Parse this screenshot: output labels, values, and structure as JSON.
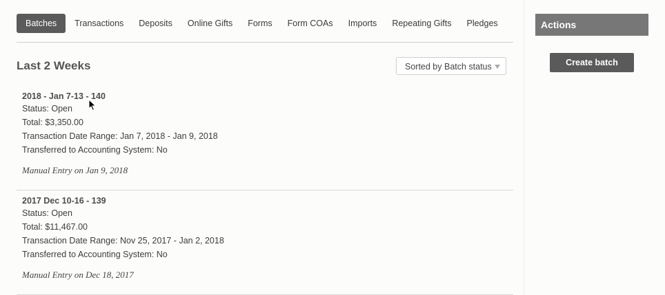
{
  "tabs": [
    {
      "label": "Batches",
      "active": true
    },
    {
      "label": "Transactions"
    },
    {
      "label": "Deposits"
    },
    {
      "label": "Online Gifts"
    },
    {
      "label": "Forms"
    },
    {
      "label": "Form COAs"
    },
    {
      "label": "Imports"
    },
    {
      "label": "Repeating Gifts"
    },
    {
      "label": "Pledges"
    }
  ],
  "section": {
    "title": "Last 2 Weeks"
  },
  "sort": {
    "label": "Sorted by Batch status"
  },
  "batches": [
    {
      "name": "2018 - Jan 7-13 - 140",
      "status": "Status: Open",
      "total": "Total: $3,350.00",
      "date_range": "Transaction Date Range: Jan 7, 2018 - Jan 9, 2018",
      "transferred": "Transferred to Accounting System: No",
      "entry": "Manual Entry on Jan 9, 2018"
    },
    {
      "name": "2017 Dec 10-16 - 139",
      "status": "Status: Open",
      "total": "Total: $11,467.00",
      "date_range": "Transaction Date Range: Nov 25, 2017 - Jan 2, 2018",
      "transferred": "Transferred to Accounting System: No",
      "entry": "Manual Entry on Dec 18, 2017"
    }
  ],
  "actions": {
    "header": "Actions",
    "create_batch": "Create batch"
  },
  "colors": {
    "active_tab": "#5b5b5b",
    "actions_header": "#777777",
    "button": "#5a5a5a"
  }
}
